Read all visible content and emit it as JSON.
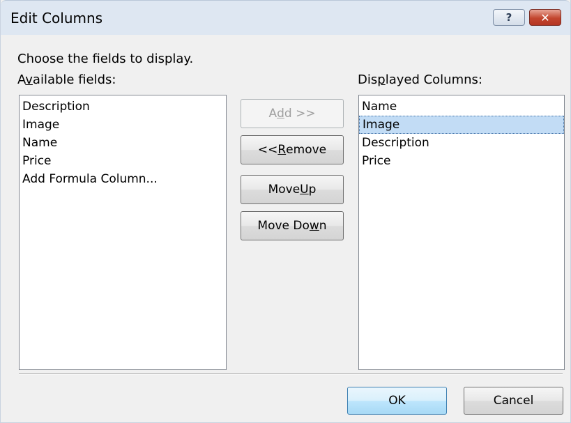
{
  "dialog": {
    "title": "Edit Columns",
    "help_glyph": "?",
    "close_glyph": "✕"
  },
  "instructions": "Choose the fields to display.",
  "available_fields": {
    "label_pre": "A",
    "label_key": "v",
    "label_post": "ailable fields:",
    "items": [
      "Description",
      "Image",
      "Name",
      "Price",
      "Add Formula Column..."
    ]
  },
  "displayed_columns": {
    "label_pre": "Dis",
    "label_key": "p",
    "label_post": "layed Columns:",
    "items": [
      "Name",
      "Image",
      "Description",
      "Price"
    ],
    "selected_index": 1
  },
  "buttons": {
    "add": {
      "pre": "A",
      "key": "d",
      "post": "d >>"
    },
    "remove": {
      "pre": "<< ",
      "key": "R",
      "post": "emove"
    },
    "move_up": {
      "pre": "Move ",
      "key": "U",
      "post": "p"
    },
    "move_down": {
      "pre": "Move Do",
      "key": "w",
      "post": "n"
    },
    "ok": "OK",
    "cancel": "Cancel"
  }
}
